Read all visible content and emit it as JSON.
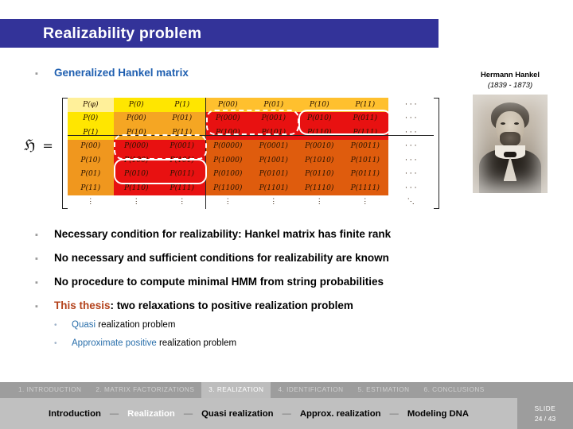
{
  "slide": {
    "title": "Realizability problem",
    "title_bar_color": "#333399"
  },
  "section_heading": {
    "marker": "▪",
    "text": "Generalized Hankel matrix",
    "color": "#1f5fb0"
  },
  "hankel": {
    "symbol": "ℌ",
    "equals": "=",
    "row_headers": [
      "P(φ)",
      "P(0)",
      "P(1)",
      "P(00)",
      "P(10)",
      "P(01)",
      "P(11)"
    ],
    "rows": [
      [
        "P(φ)",
        "P(0)",
        "P(1)",
        "P(00)",
        "P(01)",
        "P(10)",
        "P(11)",
        "· · ·"
      ],
      [
        "P(0)",
        "P(00)",
        "P(01)",
        "P(000)",
        "P(001)",
        "P(010)",
        "P(011)",
        "· · ·"
      ],
      [
        "P(1)",
        "P(10)",
        "P(11)",
        "P(100)",
        "P(101)",
        "P(110)",
        "P(111)",
        "· · ·"
      ],
      [
        "P(00)",
        "P(000)",
        "P(001)",
        "P(0000)",
        "P(0001)",
        "P(0010)",
        "P(0011)",
        "· · ·"
      ],
      [
        "P(10)",
        "P(100)",
        "P(101)",
        "P(1000)",
        "P(1001)",
        "P(1010)",
        "P(1011)",
        "· · ·"
      ],
      [
        "P(01)",
        "P(010)",
        "P(011)",
        "P(0100)",
        "P(0101)",
        "P(0110)",
        "P(0111)",
        "· · ·"
      ],
      [
        "P(11)",
        "P(110)",
        "P(111)",
        "P(1100)",
        "P(1101)",
        "P(1110)",
        "P(1111)",
        "· · ·"
      ],
      [
        "⋮",
        "⋮",
        "⋮",
        "⋮",
        "⋮",
        "⋮",
        "⋮",
        "⋱"
      ]
    ]
  },
  "portrait": {
    "name": "Hermann Hankel",
    "dates": "(1839 - 1873)"
  },
  "bullets": [
    {
      "marker": "▪",
      "text": "Necessary condition for realizability: Hankel matrix has finite rank"
    },
    {
      "marker": "▪",
      "text": "No necessary and sufficient conditions for realizability are known"
    },
    {
      "marker": "▪",
      "text": "No procedure to compute minimal HMM from string probabilities"
    }
  ],
  "thesis_bullet": {
    "marker": "▪",
    "lead": "This thesis",
    "rest": ": two relaxations to positive realization problem",
    "lead_color": "#b4431c"
  },
  "sub_bullets": [
    {
      "marker": "•",
      "highlight": "Quasi",
      "rest": " realization problem"
    },
    {
      "marker": "•",
      "highlight": "Approximate positive",
      "rest": " realization problem"
    }
  ],
  "footer": {
    "nav_items": [
      {
        "label": "1. INTRODUCTION",
        "active": false
      },
      {
        "label": "2. MATRIX FACTORIZATIONS",
        "active": false
      },
      {
        "label": "3. REALIZATION",
        "active": true
      },
      {
        "label": "4. IDENTIFICATION",
        "active": false
      },
      {
        "label": "5. ESTIMATION",
        "active": false
      },
      {
        "label": "6. CONCLUSIONS",
        "active": false
      }
    ],
    "sub_items": [
      {
        "label": "Introduction",
        "active": false
      },
      {
        "label": "Realization",
        "active": true
      },
      {
        "label": "Quasi realization",
        "active": false
      },
      {
        "label": "Approx. realization",
        "active": false
      },
      {
        "label": "Modeling DNA",
        "active": false
      }
    ],
    "separator": "—",
    "slide_label": "SLIDE",
    "slide_number": "24 / 43"
  }
}
